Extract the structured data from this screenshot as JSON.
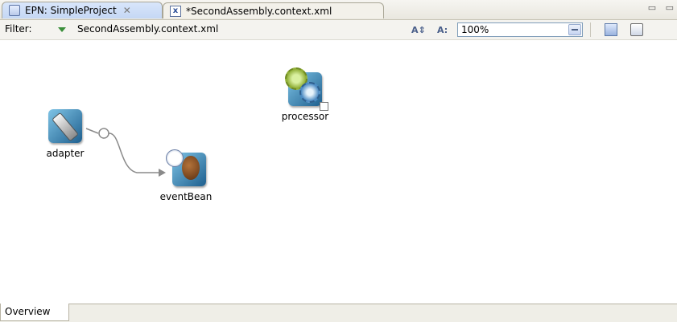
{
  "tabs": [
    {
      "label": "EPN: SimpleProject",
      "icon": "epn-icon",
      "active": true,
      "close": "✕"
    },
    {
      "label": "*SecondAssembly.context.xml",
      "icon": "xml-file-icon",
      "active": false
    }
  ],
  "filter": {
    "label": "Filter:",
    "value": "SecondAssembly.context.xml"
  },
  "toolbar": {
    "zoom": "100%",
    "icons": [
      "auto-layout-icon",
      "font-size-icon",
      "layout-icon",
      "print-icon"
    ]
  },
  "nodes": [
    {
      "id": "adapter",
      "label": "adapter",
      "icon": "adapter-icon"
    },
    {
      "id": "eventBean",
      "label": "eventBean",
      "icon": "event-bean-icon"
    },
    {
      "id": "processor",
      "label": "processor",
      "icon": "processor-icon"
    }
  ],
  "bottom": {
    "tab": "Overview"
  },
  "colors": {
    "active_tab": "#c5d7f4",
    "connector": "#8a8a8a",
    "filter_arrow": "#3a8f3a"
  }
}
